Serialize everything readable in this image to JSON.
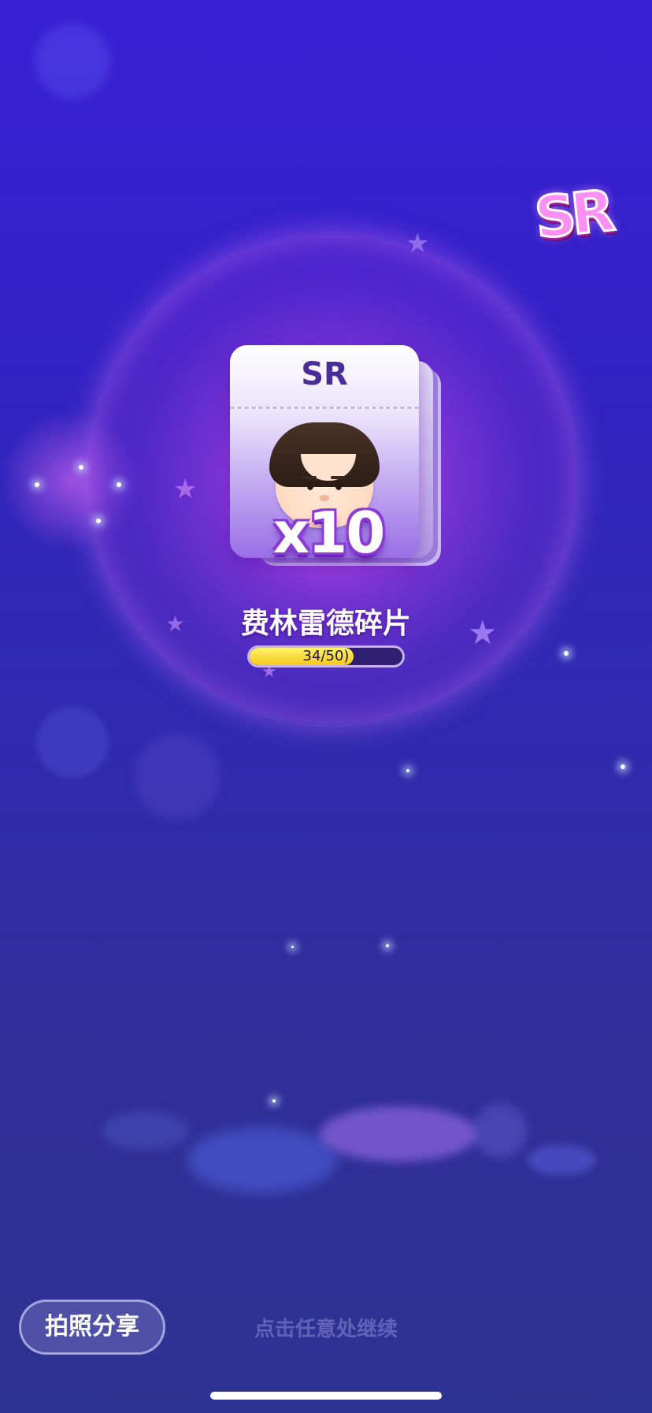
{
  "reward": {
    "rarity_badge": "SR",
    "card_rarity": "SR",
    "quantity_label": "x10",
    "item_name": "费林雷德碎片",
    "progress": {
      "current": 34,
      "max": 50,
      "fraction": 0.68,
      "label": "34/50)"
    }
  },
  "footer": {
    "share_label": "拍照分享",
    "continue_hint": "点击任意处继续"
  },
  "colors": {
    "background_top": "#3a1fd6",
    "background_bottom": "#2d3391",
    "halo": "#d64bf0",
    "progress_fill": "#f5c81c",
    "progress_track": "#2e1f73"
  },
  "icons": [
    "star-icon",
    "sparkle-icon",
    "character-portrait"
  ]
}
